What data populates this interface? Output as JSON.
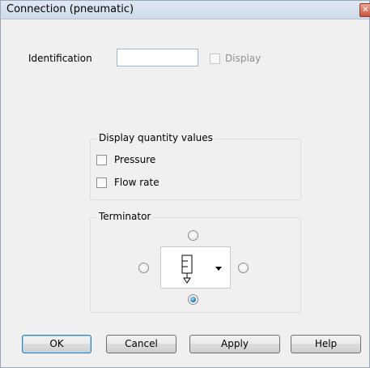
{
  "window": {
    "title": "Connection (pneumatic)",
    "close_glyph": "✕"
  },
  "identification": {
    "label": "Identification",
    "value": "",
    "display_label": "Display",
    "display_checked": false,
    "display_enabled": false
  },
  "display_quantity": {
    "title": "Display quantity values",
    "items": [
      {
        "label": "Pressure",
        "checked": false
      },
      {
        "label": "Flow rate",
        "checked": false
      }
    ]
  },
  "terminator": {
    "title": "Terminator",
    "selected": "bottom",
    "icon": "pneumatic-exhaust-silencer-icon"
  },
  "buttons": {
    "ok": "OK",
    "cancel": "Cancel",
    "apply": "Apply",
    "help": "Help"
  },
  "colors": {
    "accent": "#3c7fb1",
    "radio_selected": "#1f6fb0"
  }
}
